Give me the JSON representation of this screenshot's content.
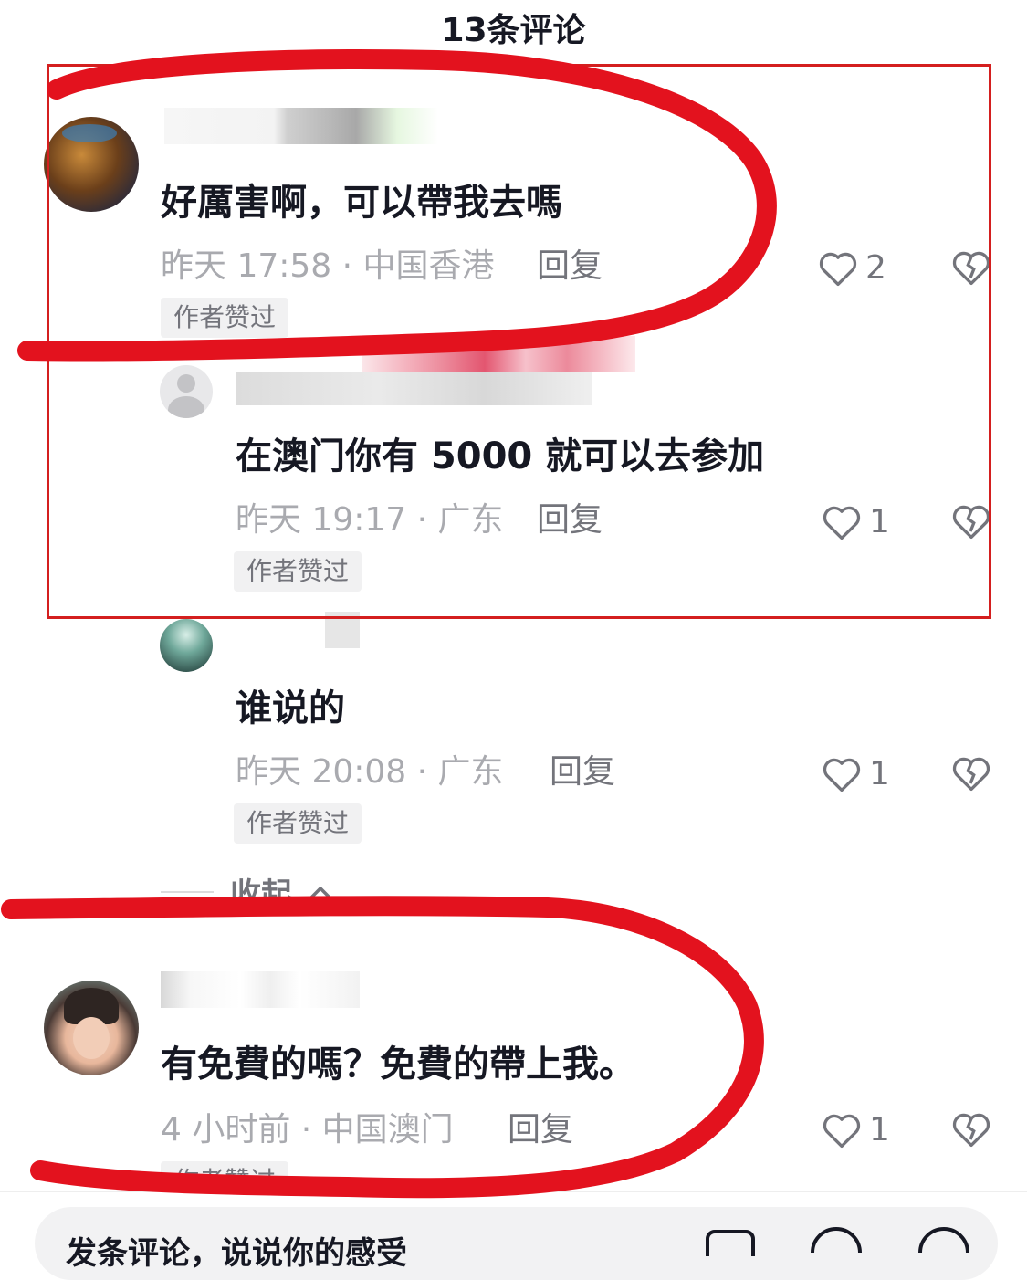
{
  "header": {
    "title": "13条评论"
  },
  "comments": [
    {
      "text": "好厲害啊，可以帶我去嗎",
      "meta": "昨天 17:58 · 中国香港",
      "reply": "回复",
      "badge": "作者赞过",
      "likes": "2"
    },
    {
      "text": "在澳门你有 5000 就可以去参加",
      "meta": "昨天 19:17 · 广东",
      "reply": "回复",
      "badge": "作者赞过",
      "likes": "1"
    },
    {
      "text": "谁说的",
      "meta": "昨天 20:08 · 广东",
      "reply": "回复",
      "badge": "作者赞过",
      "likes": "1"
    },
    {
      "text": "有免費的嗎？免費的帶上我。",
      "meta": "4 小时前 · 中国澳门",
      "reply": "回复",
      "badge": "作者赞过",
      "likes": "1"
    }
  ],
  "collapse": {
    "label": "收起"
  },
  "input": {
    "placeholder": "发条评论，说说你的感受"
  },
  "colors": {
    "annotation_red": "#d41f1f",
    "text": "#161823",
    "meta": "#a9aaaf"
  },
  "icons": [
    "heart-icon",
    "dislike-heart-icon",
    "chevron-up-icon",
    "image-icon",
    "mention-icon",
    "emoji-icon"
  ]
}
